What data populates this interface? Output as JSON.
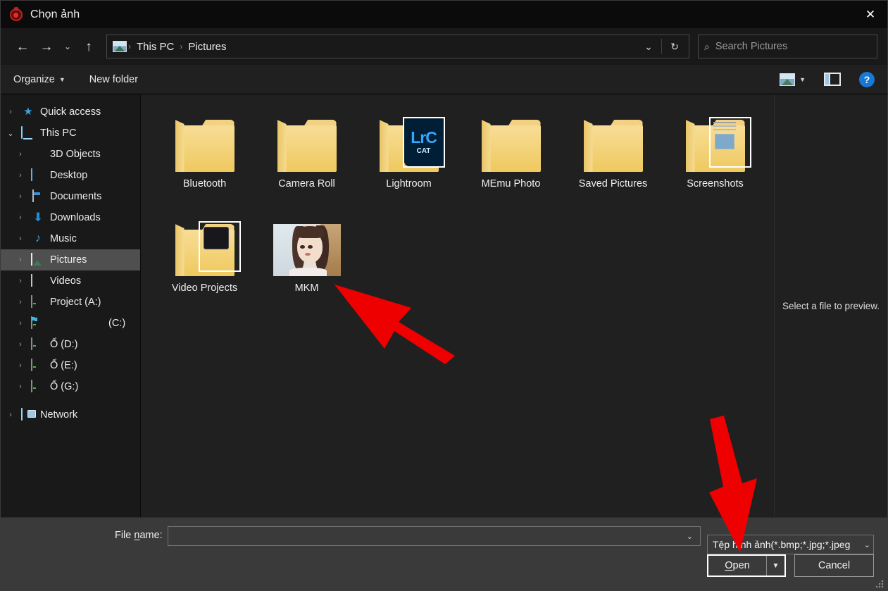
{
  "window": {
    "title": "Chọn ảnh",
    "app_icon": "app-logo-icon",
    "close_label": "✕"
  },
  "nav": {
    "back": "←",
    "forward": "→",
    "recent": "⌄",
    "up": "↑",
    "breadcrumb_icon": "pictures-folder-icon",
    "breadcrumb": [
      "This PC",
      "Pictures"
    ],
    "separator": "›",
    "history_dropdown": "⌄",
    "refresh": "↻",
    "search_placeholder": "Search Pictures",
    "search_value": "",
    "search_icon": "search-icon"
  },
  "toolbar": {
    "organize_label": "Organize",
    "organize_caret": "▼",
    "new_folder_label": "New folder",
    "view_icon": "view-options-icon",
    "view_caret": "▼",
    "preview_pane_icon": "preview-pane-icon",
    "help_label": "?"
  },
  "sidebar": {
    "items": [
      {
        "label": "Quick access",
        "icon": "star-icon",
        "chevron": "›",
        "depth": 0,
        "selected": false,
        "expanded": false
      },
      {
        "label": "This PC",
        "icon": "this-pc-icon",
        "chevron": "⌄",
        "depth": 0,
        "selected": false,
        "expanded": true
      },
      {
        "label": "3D Objects",
        "icon": "3d-objects-icon",
        "chevron": "›",
        "depth": 1,
        "selected": false,
        "expanded": false
      },
      {
        "label": "Desktop",
        "icon": "desktop-icon",
        "chevron": "›",
        "depth": 1,
        "selected": false,
        "expanded": false
      },
      {
        "label": "Documents",
        "icon": "documents-icon",
        "chevron": "›",
        "depth": 1,
        "selected": false,
        "expanded": false
      },
      {
        "label": "Downloads",
        "icon": "downloads-icon",
        "chevron": "›",
        "depth": 1,
        "selected": false,
        "expanded": false
      },
      {
        "label": "Music",
        "icon": "music-icon",
        "chevron": "›",
        "depth": 1,
        "selected": false,
        "expanded": false
      },
      {
        "label": "Pictures",
        "icon": "pictures-icon",
        "chevron": "›",
        "depth": 1,
        "selected": true,
        "expanded": false
      },
      {
        "label": "Videos",
        "icon": "videos-icon",
        "chevron": "›",
        "depth": 1,
        "selected": false,
        "expanded": false
      },
      {
        "label": "Project (A:)",
        "icon": "drive-icon",
        "chevron": "›",
        "depth": 1,
        "selected": false,
        "expanded": false
      },
      {
        "label": "(C:)",
        "icon": "system-drive-icon",
        "chevron": "›",
        "depth": 1,
        "selected": false,
        "expanded": false,
        "redacted": true
      },
      {
        "label": "Ổ (D:)",
        "icon": "drive-icon",
        "chevron": "›",
        "depth": 1,
        "selected": false,
        "expanded": false
      },
      {
        "label": "Ổ (E:)",
        "icon": "drive-icon",
        "chevron": "›",
        "depth": 1,
        "selected": false,
        "expanded": false
      },
      {
        "label": "Ổ (G:)",
        "icon": "drive-icon",
        "chevron": "›",
        "depth": 1,
        "selected": false,
        "expanded": false
      },
      {
        "label": "Network",
        "icon": "network-icon",
        "chevron": "›",
        "depth": 0,
        "selected": false,
        "expanded": false
      }
    ]
  },
  "files": {
    "items": [
      {
        "name": "Bluetooth",
        "type": "folder",
        "overlay": "none"
      },
      {
        "name": "Camera Roll",
        "type": "folder",
        "overlay": "none"
      },
      {
        "name": "Lightroom",
        "type": "folder",
        "overlay": "lightroom-catalog-icon",
        "overlay_main": "LrC",
        "overlay_sub": "CAT"
      },
      {
        "name": "MEmu Photo",
        "type": "folder",
        "overlay": "none"
      },
      {
        "name": "Saved Pictures",
        "type": "folder",
        "overlay": "none"
      },
      {
        "name": "Screenshots",
        "type": "folder",
        "overlay": "screenshot-thumbnail"
      },
      {
        "name": "Video Projects",
        "type": "folder",
        "overlay": "video-thumbnail"
      },
      {
        "name": "MKM",
        "type": "image",
        "overlay": "portrait-photo-thumbnail"
      }
    ]
  },
  "preview": {
    "message": "Select a file to preview."
  },
  "footer": {
    "file_name_label_pre": "File ",
    "file_name_label_accel": "n",
    "file_name_label_post": "ame:",
    "file_name_value": "",
    "file_name_caret": "⌄",
    "filter_value": "Tệp hình ảnh(*.bmp;*.jpg;*.jpeg",
    "filter_caret": "⌄",
    "open_label_accel": "O",
    "open_label_rest": "pen",
    "open_split_caret": "▼",
    "cancel_label": "Cancel"
  },
  "annotations": {
    "arrow_color": "#ee0000",
    "arrows": [
      {
        "name": "arrow-pointing-to-mkm-file",
        "target": "MKM"
      },
      {
        "name": "arrow-pointing-to-file-type-filter",
        "target": "Tệp hình ảnh(*.bmp;*.jpg;*.jpeg"
      }
    ]
  }
}
